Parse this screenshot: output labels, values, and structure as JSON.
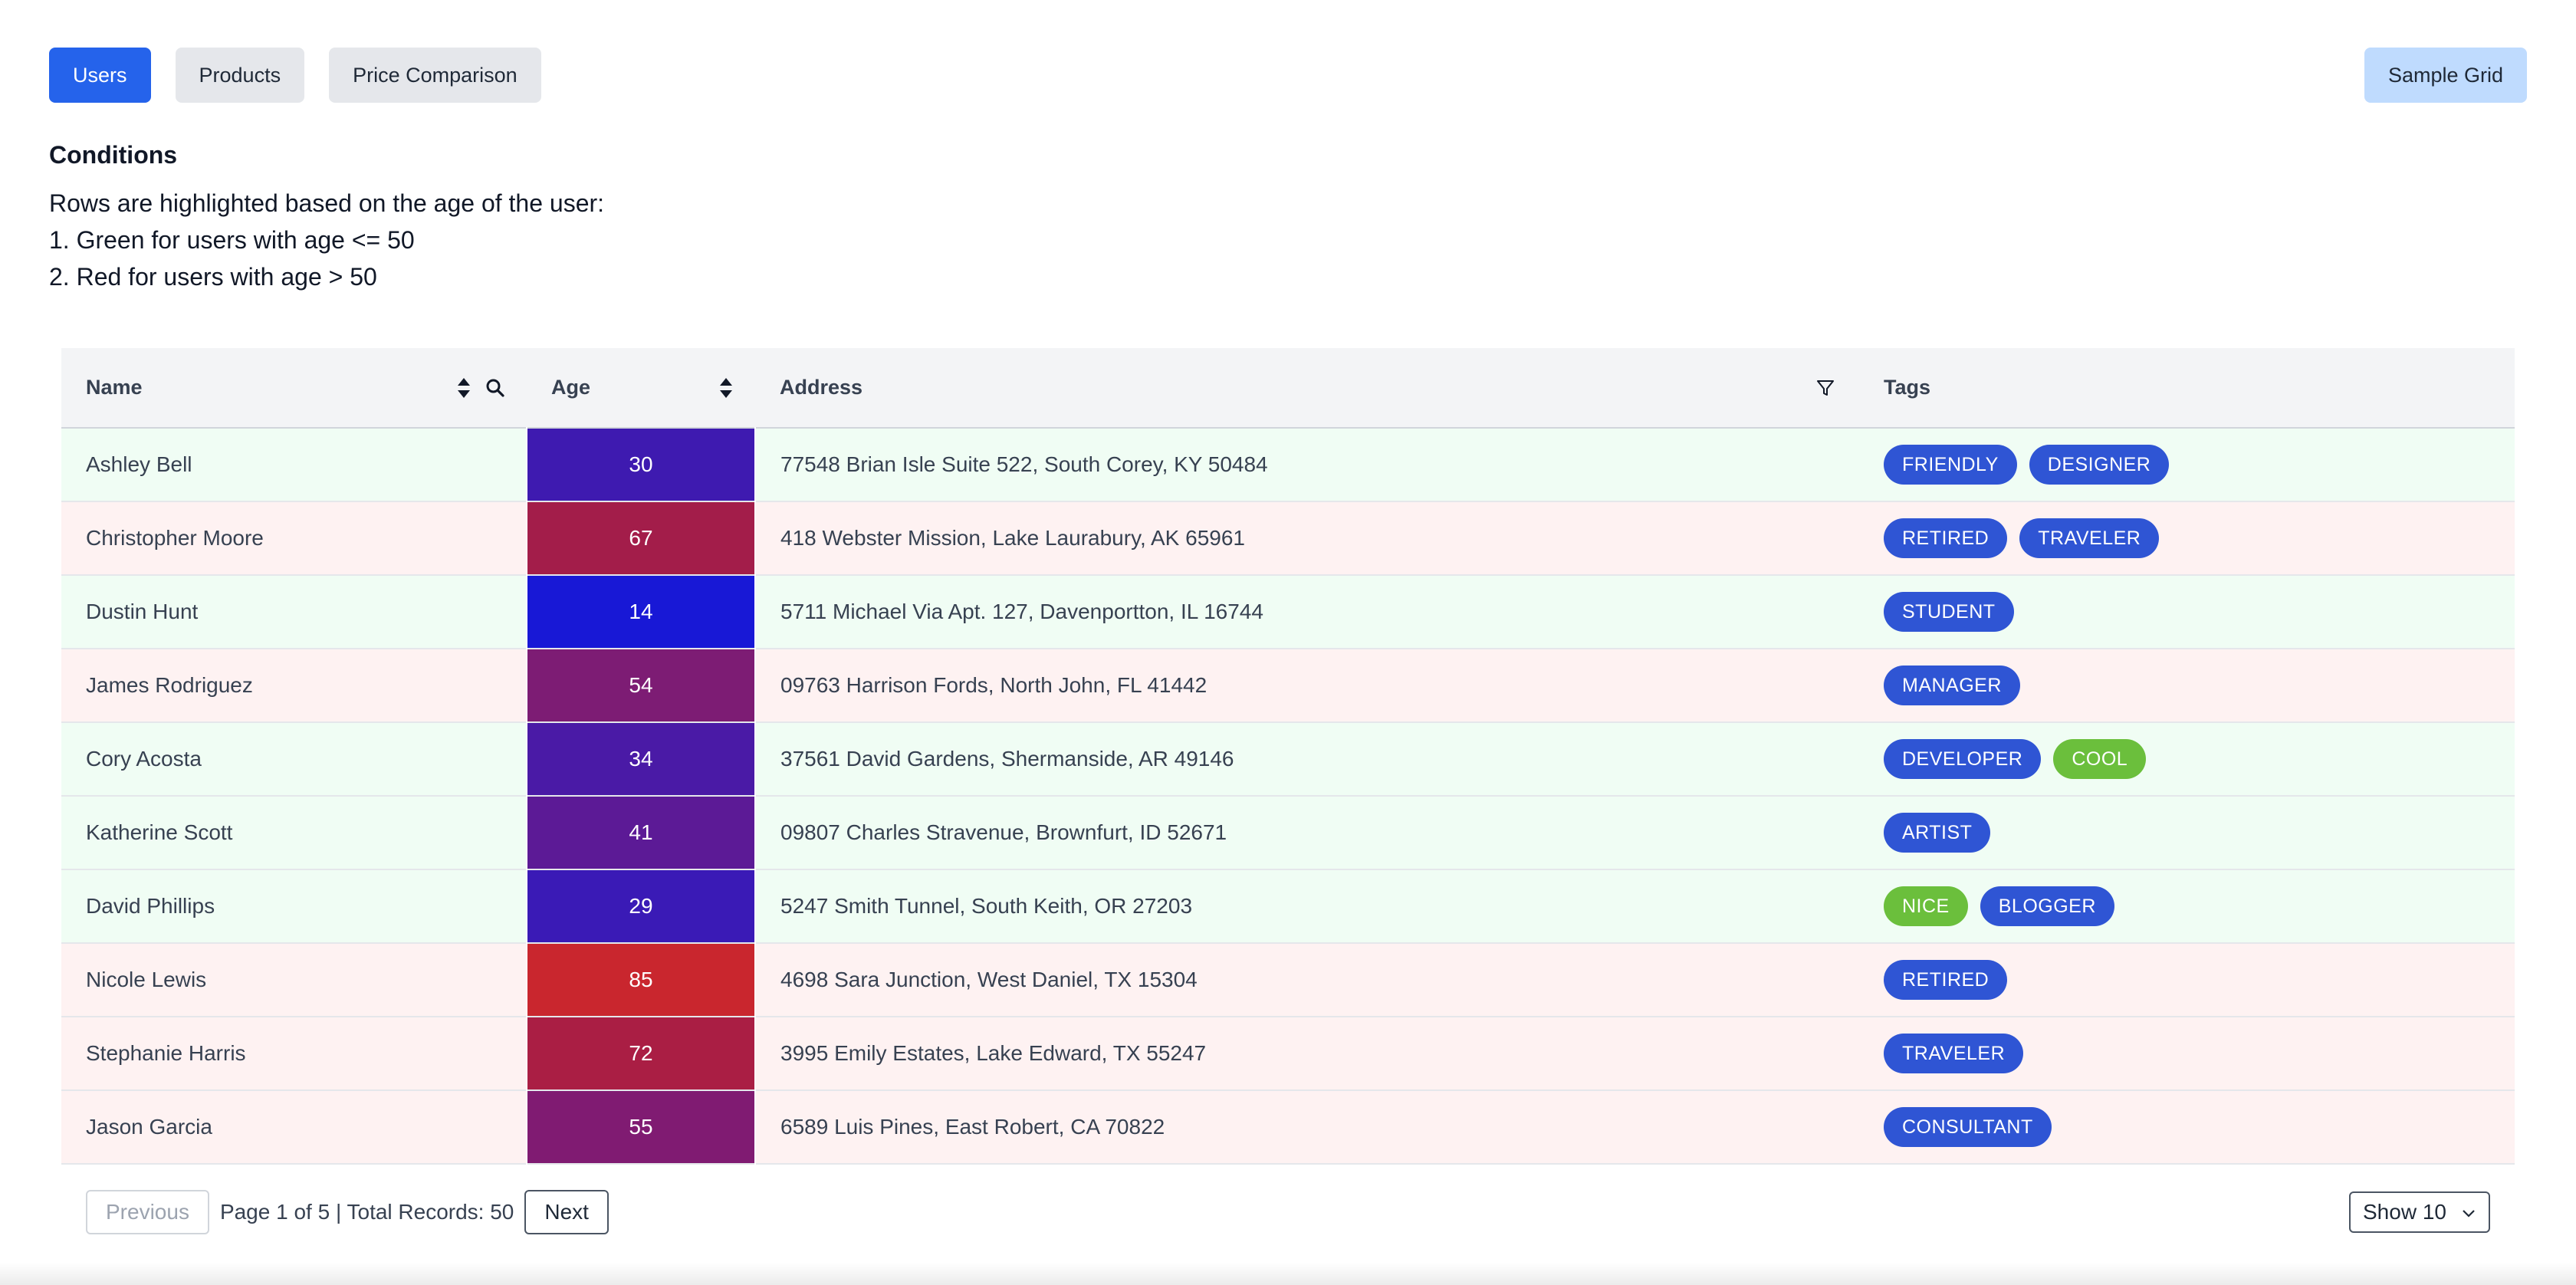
{
  "nav": {
    "tabs": [
      {
        "label": "Users",
        "active": true
      },
      {
        "label": "Products",
        "active": false
      },
      {
        "label": "Price Comparison",
        "active": false
      }
    ],
    "sample_grid_label": "Sample Grid"
  },
  "conditions": {
    "title": "Conditions",
    "lines": [
      "Rows are highlighted based on the age of the user:",
      "1. Green for users with age <= 50",
      "2. Red for users with age > 50"
    ]
  },
  "table": {
    "columns": [
      "Name",
      "Age",
      "Address",
      "Tags"
    ],
    "rows": [
      {
        "name": "Ashley Bell",
        "age": "30",
        "address": "77548 Brian Isle Suite 522, South Corey, KY 50484",
        "tags": [
          {
            "label": "FRIENDLY",
            "color": "blue"
          },
          {
            "label": "DESIGNER",
            "color": "blue"
          }
        ],
        "age_color": "#3e1ab0",
        "row_status": "young"
      },
      {
        "name": "Christopher Moore",
        "age": "67",
        "address": "418 Webster Mission, Lake Laurabury, AK 65961",
        "tags": [
          {
            "label": "RETIRED",
            "color": "blue"
          },
          {
            "label": "TRAVELER",
            "color": "blue"
          }
        ],
        "age_color": "#a31d4a",
        "row_status": "old"
      },
      {
        "name": "Dustin Hunt",
        "age": "14",
        "address": "5711 Michael Via Apt. 127, Davenportton, IL 16744",
        "tags": [
          {
            "label": "STUDENT",
            "color": "blue"
          }
        ],
        "age_color": "#1818d6",
        "row_status": "young"
      },
      {
        "name": "James Rodriguez",
        "age": "54",
        "address": "09763 Harrison Fords, North John, FL 41442",
        "tags": [
          {
            "label": "MANAGER",
            "color": "blue"
          }
        ],
        "age_color": "#7d1c74",
        "row_status": "old"
      },
      {
        "name": "Cory Acosta",
        "age": "34",
        "address": "37561 David Gardens, Shermanside, AR 49146",
        "tags": [
          {
            "label": "DEVELOPER",
            "color": "blue"
          },
          {
            "label": "COOL",
            "color": "green"
          }
        ],
        "age_color": "#4a1aa6",
        "row_status": "young"
      },
      {
        "name": "Katherine Scott",
        "age": "41",
        "address": "09807 Charles Stravenue, Brownfurt, ID 52671",
        "tags": [
          {
            "label": "ARTIST",
            "color": "blue"
          }
        ],
        "age_color": "#5c1a96",
        "row_status": "young"
      },
      {
        "name": "David Phillips",
        "age": "29",
        "address": "5247 Smith Tunnel, South Keith, OR 27203",
        "tags": [
          {
            "label": "NICE",
            "color": "green"
          },
          {
            "label": "BLOGGER",
            "color": "blue"
          }
        ],
        "age_color": "#3a1ab6",
        "row_status": "young"
      },
      {
        "name": "Nicole Lewis",
        "age": "85",
        "address": "4698 Sara Junction, West Daniel, TX 15304",
        "tags": [
          {
            "label": "RETIRED",
            "color": "blue"
          }
        ],
        "age_color": "#c9262e",
        "row_status": "old"
      },
      {
        "name": "Stephanie Harris",
        "age": "72",
        "address": "3995 Emily Estates, Lake Edward, TX 55247",
        "tags": [
          {
            "label": "TRAVELER",
            "color": "blue"
          }
        ],
        "age_color": "#aa1e44",
        "row_status": "old"
      },
      {
        "name": "Jason Garcia",
        "age": "55",
        "address": "6589 Luis Pines, East Robert, CA 70822",
        "tags": [
          {
            "label": "CONSULTANT",
            "color": "blue"
          }
        ],
        "age_color": "#801b72",
        "row_status": "old"
      }
    ]
  },
  "pagination": {
    "previous_label": "Previous",
    "info": "Page 1 of 5 | Total Records: 50",
    "next_label": "Next",
    "show_label": "Show 10"
  },
  "colors": {
    "primary": "#2563eb",
    "young_row": "#f0fdf4",
    "old_row": "#fef2f2",
    "tag_blue": "#2f55d4",
    "tag_green": "#6bbf3c"
  }
}
